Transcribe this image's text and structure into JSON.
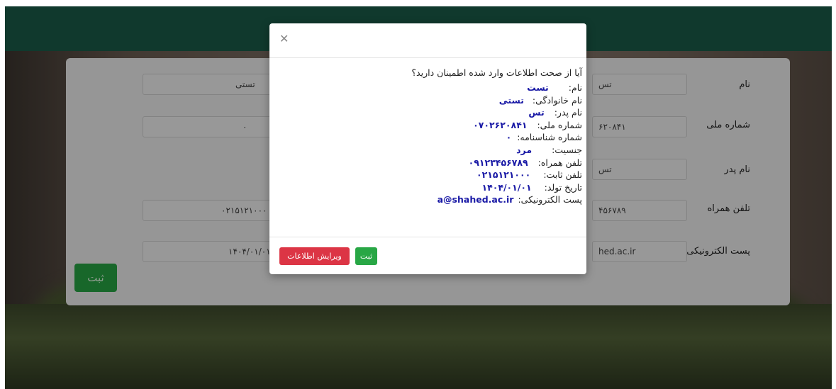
{
  "colors": {
    "header": "#1a5c4a",
    "primary_green": "#28a745",
    "danger_red": "#dc3545",
    "value_blue": "#1a1aa6"
  },
  "form": {
    "rows": [
      {
        "label": "نام",
        "right_value": "تس",
        "left_value": "تستی"
      },
      {
        "label": "شماره ملی",
        "right_value": "۶۲۰۸۴۱",
        "left_value": "۰"
      },
      {
        "label": "نام پدر",
        "right_value": "تس",
        "left_value": ""
      },
      {
        "label": "تلفن همراه",
        "right_value": "۴۵۶۷۸۹",
        "left_value": "۰۲۱۵۱۲۱۰۰۰"
      },
      {
        "label": "پست الکترونیکی",
        "right_value": "hed.ac.ir",
        "left_value": "۱۴۰۴/۰۱/۰۱"
      }
    ],
    "submit_label": "ثبت"
  },
  "modal": {
    "close_icon": "close-icon",
    "question": "آیا از صحت اطلاعات وارد شده اطمینان دارید؟",
    "fields": [
      {
        "label": "نام:",
        "value": "تست"
      },
      {
        "label": "نام خانوادگی:",
        "value": "تستی"
      },
      {
        "label": "نام پدر:",
        "value": "تس"
      },
      {
        "label": "شماره ملی:",
        "value": "۰۷۰۲۶۲۰۸۴۱"
      },
      {
        "label": "شماره شناسنامه:",
        "value": "۰"
      },
      {
        "label": "جنسیت:",
        "value": "مرد"
      },
      {
        "label": "تلفن همراه:",
        "value": "۰۹۱۲۳۴۵۶۷۸۹"
      },
      {
        "label": "تلفن ثابت:",
        "value": "۰۲۱۵۱۲۱۰۰۰"
      },
      {
        "label": "تاریخ تولد:",
        "value": "۱۴۰۴/۰۱/۰۱"
      },
      {
        "label": "پست الکترونیکی:",
        "value": "a@shahed.ac.ir"
      }
    ],
    "confirm_label": "ثبت",
    "edit_label": "ویرایش اطلاعات"
  }
}
